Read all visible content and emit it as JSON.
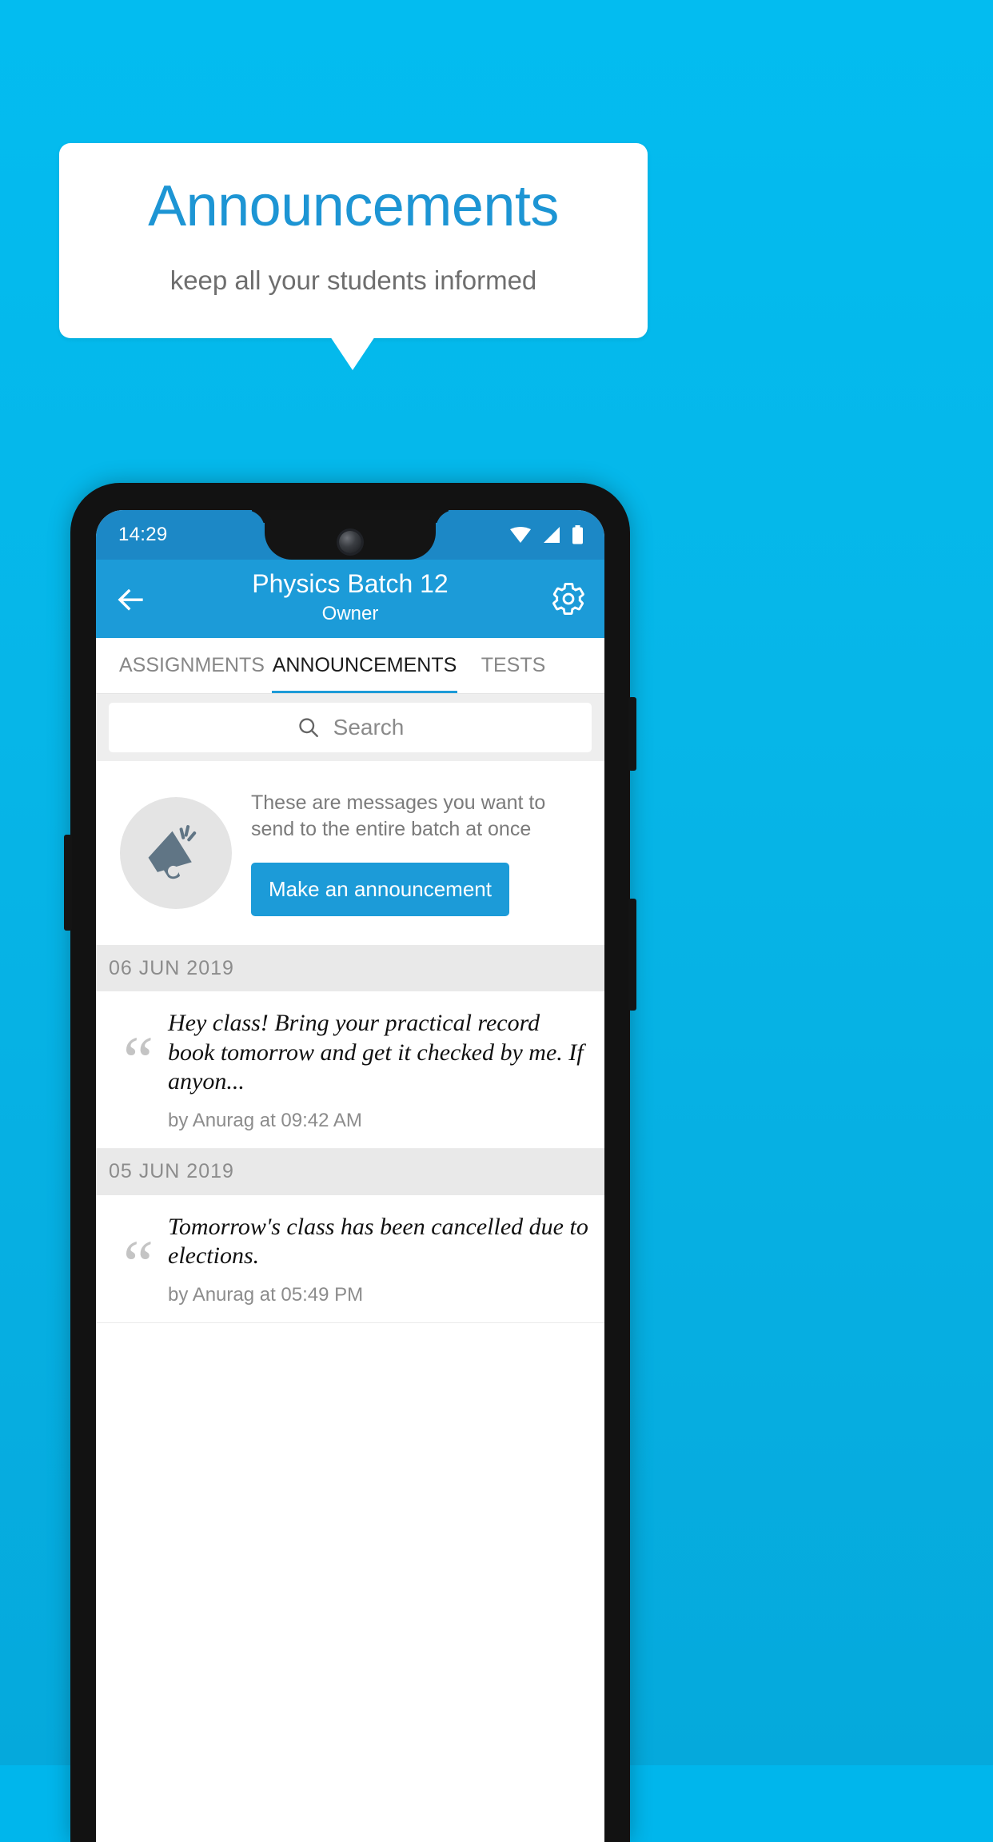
{
  "promo": {
    "title": "Announcements",
    "subtitle": "keep all your students informed",
    "title_color": "#1D95D4",
    "background_color": "#06B6E8"
  },
  "phone": {
    "statusbar": {
      "time": "14:29",
      "icons": [
        "wifi-icon",
        "signal-icon",
        "battery-icon"
      ]
    },
    "appbar": {
      "back_icon": "back-arrow-icon",
      "title": "Physics Batch 12",
      "subtitle": "Owner",
      "settings_icon": "gear-icon",
      "color": "#1C9BD8"
    },
    "tabs": [
      {
        "label": "ASSIGNMENTS",
        "active": false
      },
      {
        "label": "ANNOUNCEMENTS",
        "active": true
      },
      {
        "label": "TESTS",
        "active": false
      },
      {
        "label": "",
        "active": false
      }
    ],
    "search": {
      "placeholder": "Search",
      "value": "",
      "icon": "search-icon"
    },
    "promo_card": {
      "icon": "megaphone-icon",
      "description": "These are messages you want to send to the entire batch at once",
      "button_label": "Make an announcement",
      "button_color": "#1C9BD8"
    },
    "groups": [
      {
        "date": "06  JUN  2019",
        "items": [
          {
            "text": "Hey class! Bring your practical record book tomorrow and get it checked by me. If anyon...",
            "meta": "by Anurag at 09:42 AM"
          }
        ]
      },
      {
        "date": "05  JUN  2019",
        "items": [
          {
            "text": "Tomorrow's class has been cancelled due to elections.",
            "meta": "by Anurag at 05:49 PM"
          }
        ]
      }
    ]
  }
}
